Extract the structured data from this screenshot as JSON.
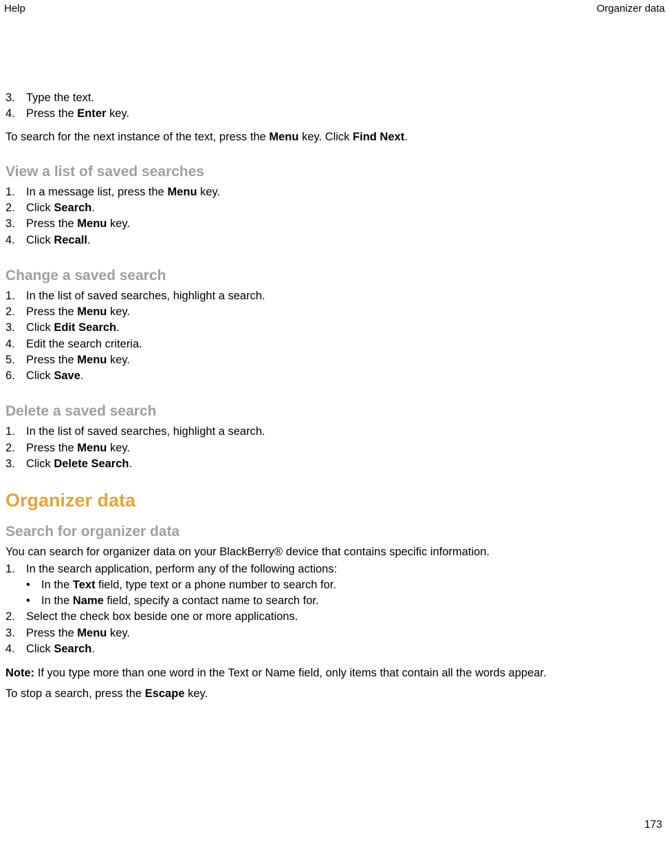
{
  "header": {
    "left": "Help",
    "right": "Organizer data"
  },
  "intro_list": {
    "num3": "3.",
    "txt3_a": "Type the text.",
    "num4": "4.",
    "txt4_a": "Press the ",
    "txt4_b": "Enter",
    "txt4_c": " key."
  },
  "intro_para": {
    "a": "To search for the next instance of the text, press the ",
    "b": "Menu",
    "c": " key. Click ",
    "d": "Find Next",
    "e": "."
  },
  "sec1": {
    "title": "View a list of saved searches",
    "n1": "1.",
    "t1a": "In a message list, press the ",
    "t1b": "Menu",
    "t1c": " key.",
    "n2": "2.",
    "t2a": "Click ",
    "t2b": "Search",
    "t2c": ".",
    "n3": "3.",
    "t3a": "Press the ",
    "t3b": "Menu",
    "t3c": " key.",
    "n4": "4.",
    "t4a": "Click ",
    "t4b": "Recall",
    "t4c": "."
  },
  "sec2": {
    "title": "Change a saved search",
    "n1": "1.",
    "t1": "In the list of saved searches, highlight a search.",
    "n2": "2.",
    "t2a": "Press the ",
    "t2b": "Menu",
    "t2c": " key.",
    "n3": "3.",
    "t3a": "Click ",
    "t3b": "Edit Search",
    "t3c": ".",
    "n4": "4.",
    "t4": "Edit the search criteria.",
    "n5": "5.",
    "t5a": "Press the ",
    "t5b": "Menu",
    "t5c": " key.",
    "n6": "6.",
    "t6a": "Click ",
    "t6b": "Save",
    "t6c": "."
  },
  "sec3": {
    "title": "Delete a saved search",
    "n1": "1.",
    "t1": "In the list of saved searches, highlight a search.",
    "n2": "2.",
    "t2a": "Press the ",
    "t2b": "Menu",
    "t2c": " key.",
    "n3": "3.",
    "t3a": "Click ",
    "t3b": "Delete Search",
    "t3c": "."
  },
  "major": {
    "title": "Organizer data"
  },
  "sec4": {
    "title": "Search for organizer data",
    "intro": "You can search for organizer data on your BlackBerry® device that contains specific information.",
    "n1": "1.",
    "t1": "In the search application, perform any of the following actions:",
    "b1a": "In the ",
    "b1b": "Text",
    "b1c": " field, type text or a phone number to search for.",
    "b2a": "In the ",
    "b2b": "Name",
    "b2c": " field, specify a contact name to search for.",
    "n2": "2.",
    "t2": "Select the check box beside one or more applications.",
    "n3": "3.",
    "t3a": "Press the ",
    "t3b": "Menu",
    "t3c": " key.",
    "n4": "4.",
    "t4a": "Click ",
    "t4b": "Search",
    "t4c": "."
  },
  "note": {
    "label": "Note:",
    "text": "  If you type more than one word in the Text or Name field, only items that contain all the words appear."
  },
  "stop": {
    "a": "To stop a search, press the ",
    "b": "Escape",
    "c": " key."
  },
  "page_number": "173",
  "bullet": "•"
}
